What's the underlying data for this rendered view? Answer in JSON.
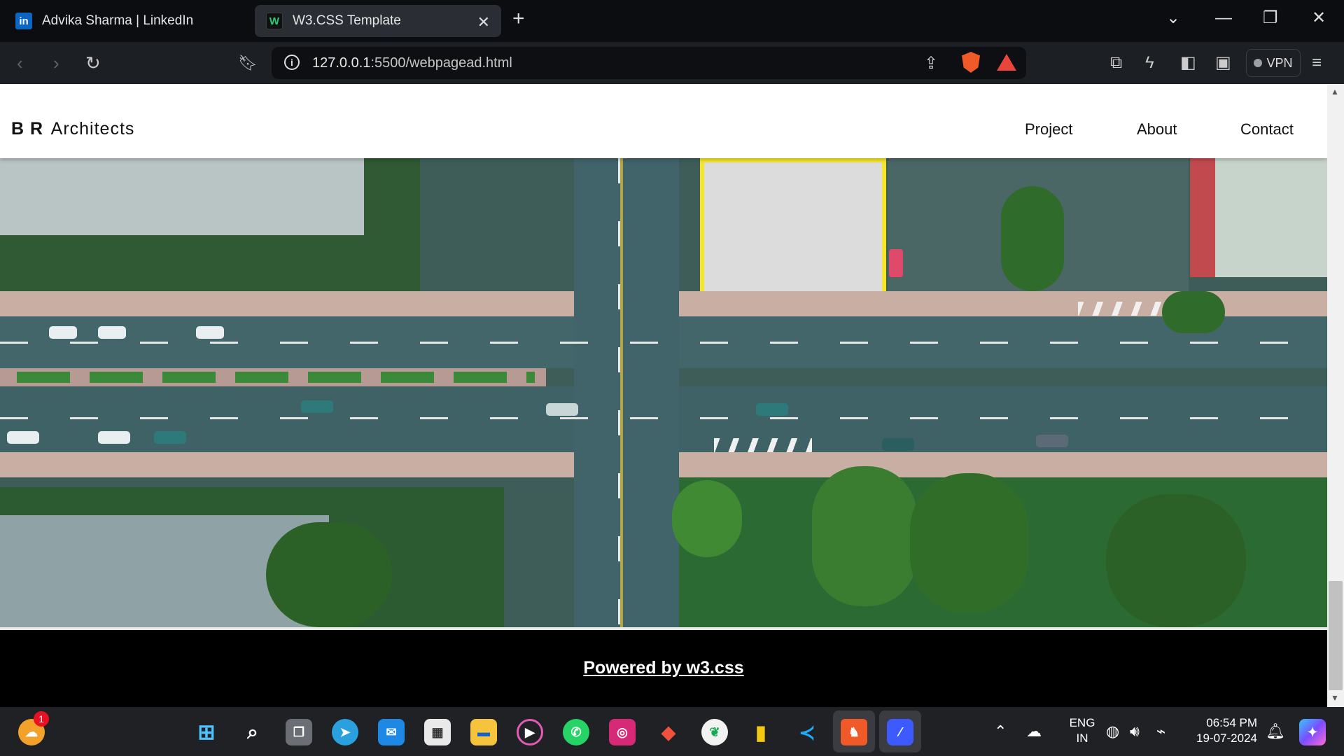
{
  "browser": {
    "tabs": [
      {
        "title": "Advika Sharma | LinkedIn",
        "favicon": "in",
        "active": false
      },
      {
        "title": "W3.CSS Template",
        "favicon": "W",
        "active": true
      }
    ],
    "new_tab_label": "+",
    "url_host": "127.0.0.1",
    "url_path": ":5500/webpagead.html",
    "vpn_label": "VPN"
  },
  "site": {
    "brand_bold": "B R",
    "brand_rest": "Architects",
    "nav": [
      "Project",
      "About",
      "Contact"
    ],
    "footer_text": "Powered by w3.css"
  },
  "taskbar": {
    "notification_count": "1",
    "lang_line1": "ENG",
    "lang_line2": "IN",
    "time": "06:54 PM",
    "date": "19-07-2024"
  },
  "colors": {
    "tab_bg": "#0b0d10",
    "toolbar_bg": "#1c1f24",
    "footer_bg": "#000000",
    "taskbar_bg": "#1f2125"
  }
}
